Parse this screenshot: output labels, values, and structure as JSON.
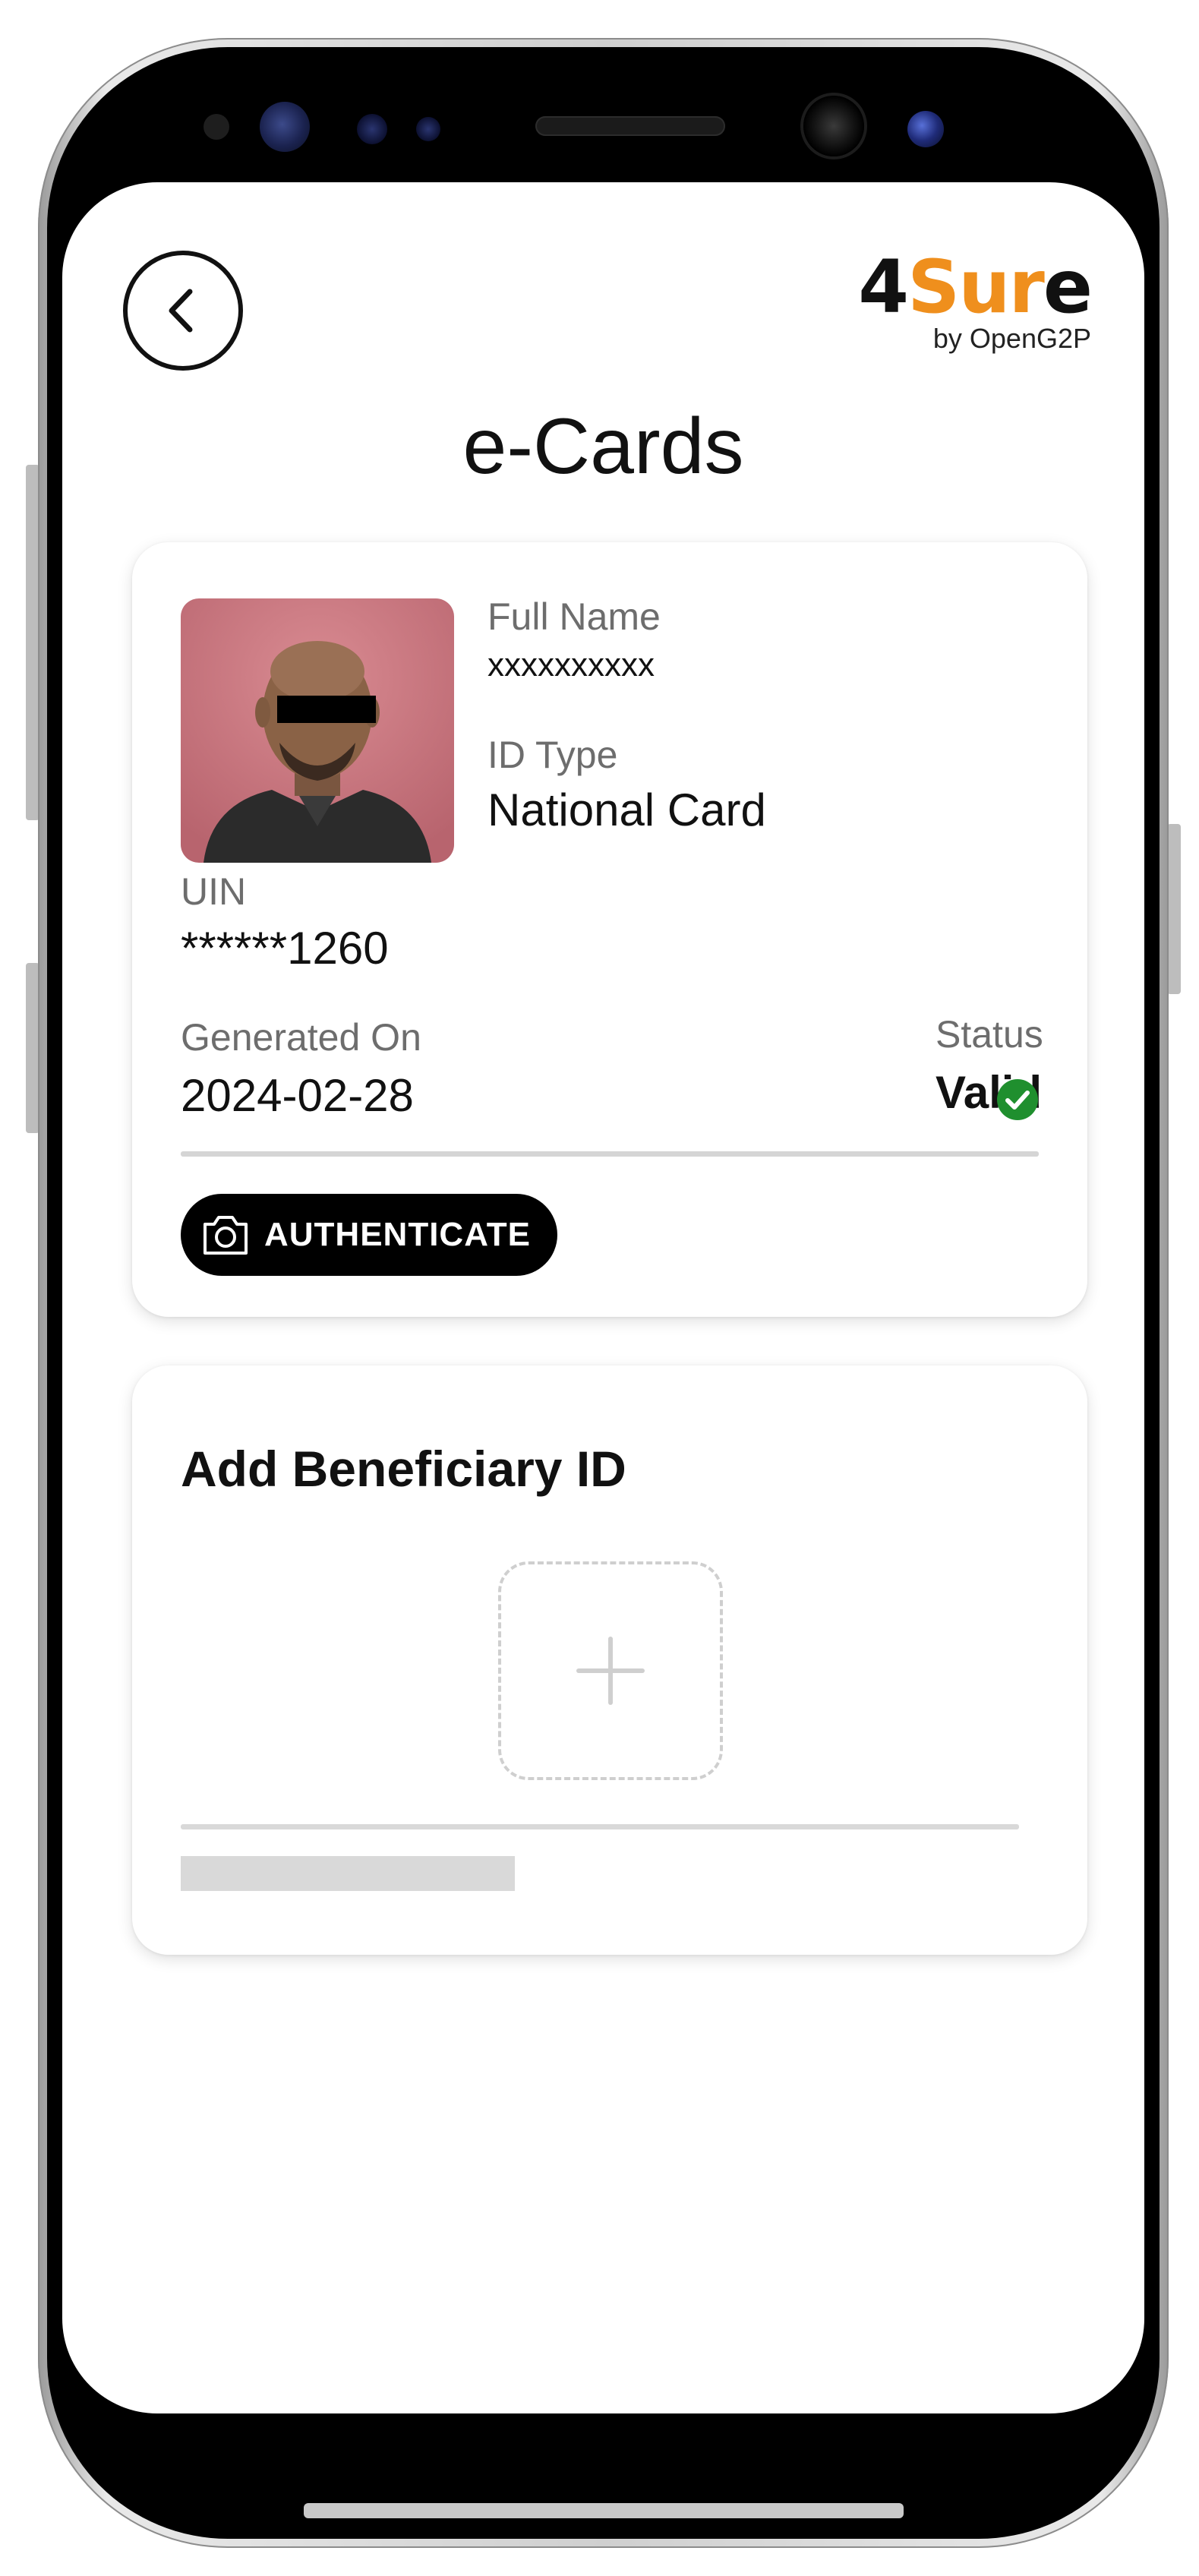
{
  "header": {
    "brand": {
      "digit": "4",
      "accent": "Sur",
      "tail": "e",
      "tagline": "by OpenG2P"
    },
    "title": "e-Cards",
    "back_icon": "chevron-left-icon"
  },
  "ecard": {
    "photo_alt": "profile-photo",
    "full_name": {
      "label": "Full Name",
      "value": "xxxxxxxxxx"
    },
    "id_type": {
      "label": "ID Type",
      "value": "National Card"
    },
    "uin": {
      "label": "UIN",
      "value": "******1260"
    },
    "generated_on": {
      "label": "Generated On",
      "value": "2024-02-28"
    },
    "status": {
      "label": "Status",
      "value": "Valid",
      "icon": "check-circle-icon",
      "color": "#1f8f2e"
    },
    "authenticate_button": {
      "label": "AUTHENTICATE",
      "icon": "camera-icon"
    }
  },
  "add_beneficiary": {
    "title": "Add Beneficiary ID",
    "add_icon": "plus-icon"
  },
  "colors": {
    "brand_orange": "#ef8f1d",
    "primary_text": "#111111",
    "secondary_text": "#6d6d6d",
    "button_bg": "#000000"
  }
}
